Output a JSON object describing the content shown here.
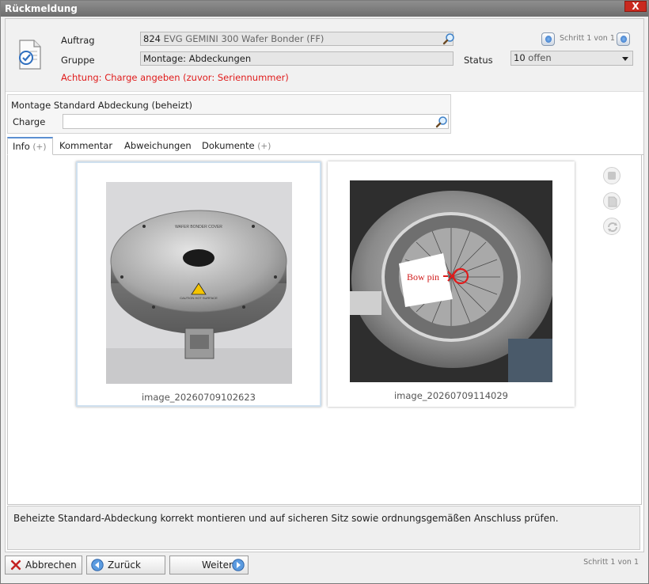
{
  "window": {
    "title": "Rückmeldung",
    "close_label": "X"
  },
  "header": {
    "auftrag_label": "Auftrag",
    "auftrag_number": "824",
    "auftrag_text": "EVG GEMINI 300 Wafer Bonder (FF)",
    "gruppe_label": "Gruppe",
    "gruppe_value": "Montage: Abdeckungen",
    "warning": "Achtung: Charge angeben (zuvor: Seriennummer)",
    "step_indicator": "Schritt 1 von 1",
    "status_label": "Status",
    "status_number": "10",
    "status_text": "offen"
  },
  "panel": {
    "title": "Montage Standard Abdeckung (beheizt)",
    "charge_label": "Charge",
    "charge_value": ""
  },
  "tabs": [
    {
      "label": "Info",
      "suffix": "(+)"
    },
    {
      "label": "Kommentar",
      "suffix": ""
    },
    {
      "label": "Abweichungen",
      "suffix": ""
    },
    {
      "label": "Dokumente",
      "suffix": "(+)"
    }
  ],
  "images": [
    {
      "caption": "image_20260709102623",
      "icon": "wafer-bonder-cover-photo",
      "label_text": "WAFER BONDER COVER",
      "sticker_text": "CAUTION HOT SURFACE"
    },
    {
      "caption": "image_20260709114029",
      "icon": "bow-pin-chamber-photo",
      "annotation": "Bow pin"
    }
  ],
  "description": "Beheizte Standard-Abdeckung korrekt montieren und auf sicheren Sitz sowie ordnungsgemäßen Anschluss prüfen.",
  "footer": {
    "cancel_label": "Abbrechen",
    "back_label": "Zurück",
    "next_label": "Weiter",
    "step_indicator": "Schritt 1 von 1"
  },
  "colors": {
    "warning": "#e01b1b",
    "accent": "#5b8fd1",
    "titlebar": "#7e7e7e",
    "close": "#c9291f"
  }
}
